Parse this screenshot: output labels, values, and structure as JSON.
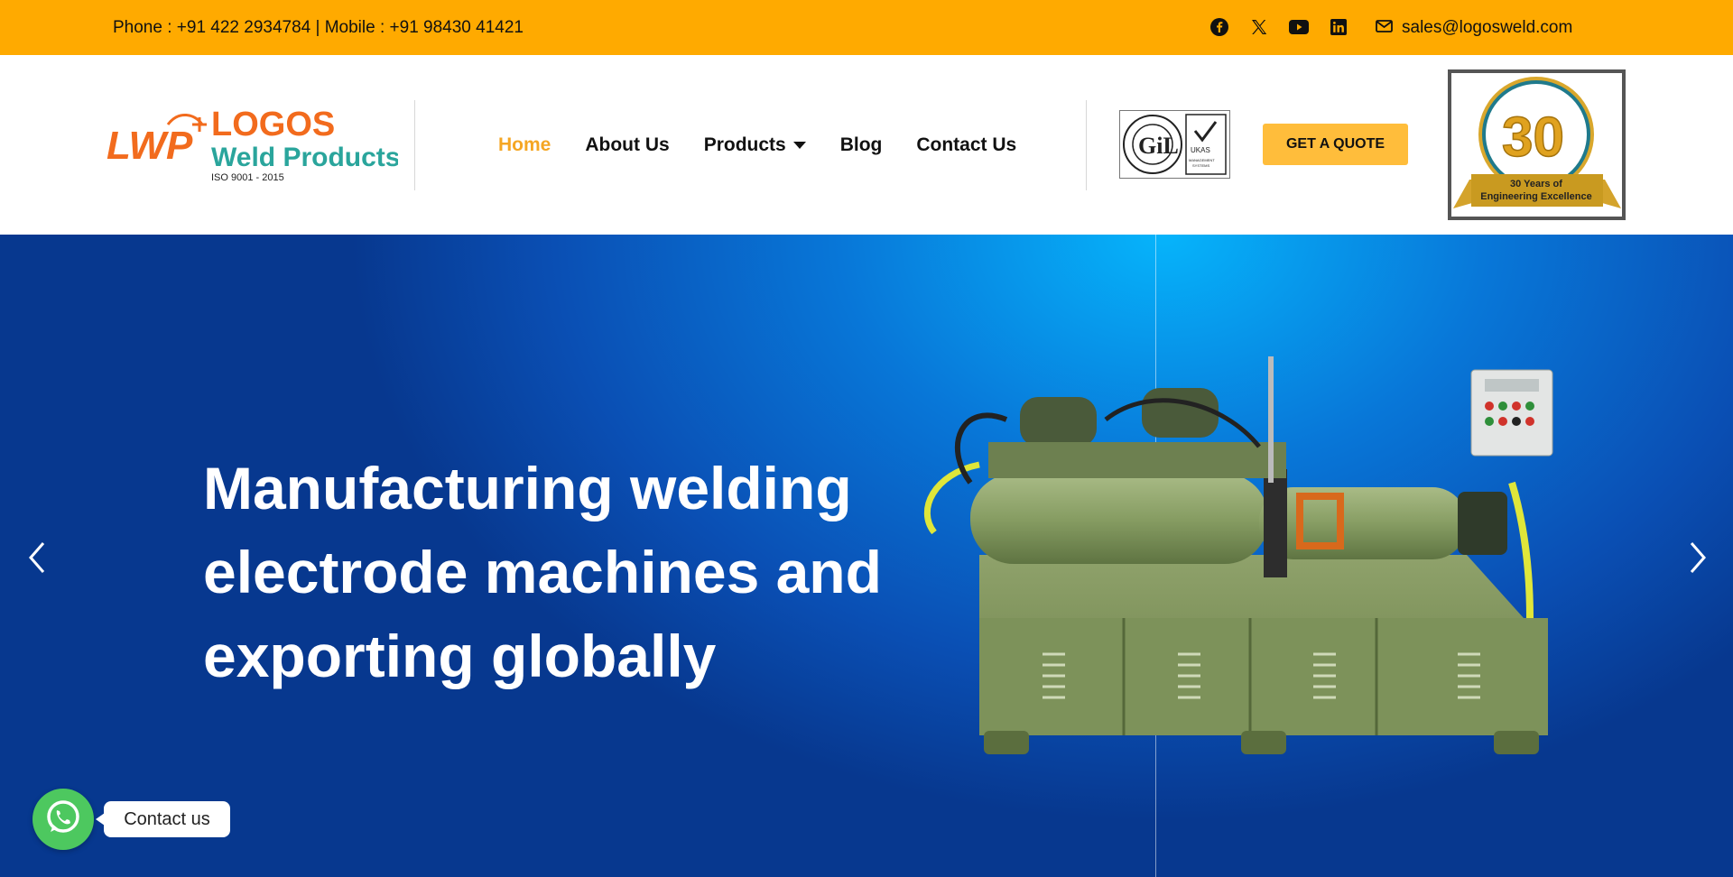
{
  "topbar": {
    "contact_text": "Phone : +91 422 2934784 | Mobile : +91 98430 41421",
    "social_icons": [
      "facebook-icon",
      "x-twitter-icon",
      "youtube-icon",
      "linkedin-icon"
    ],
    "email": "sales@logosweld.com",
    "background_color": "#ffaa00"
  },
  "header": {
    "logo": {
      "mark": "LWP",
      "name_line1": "LOGOS",
      "name_line2": "Weld Products",
      "tagline": "ISO 9001 - 2015"
    },
    "nav": {
      "items": [
        {
          "label": "Home",
          "active": true
        },
        {
          "label": "About Us"
        },
        {
          "label": "Products",
          "has_dropdown": true
        },
        {
          "label": "Blog"
        },
        {
          "label": "Contact Us"
        }
      ],
      "active_color": "#f5a623"
    },
    "certification": {
      "left_text": "GUARDIAN INDEPENDENT CERTIFICATION",
      "right_text": "UKAS MANAGEMENT SYSTEMS"
    },
    "quote_button": "GET A QUOTE",
    "anniversary_badge": {
      "number": "30",
      "line1": "30 Years of",
      "line2": "Engineering Excellence"
    }
  },
  "hero": {
    "heading_lines": [
      "Manufacturing welding",
      "electrode machines and",
      "exporting globally"
    ],
    "prev_icon": "chevron-left-icon",
    "next_icon": "chevron-right-icon"
  },
  "whatsapp": {
    "icon": "whatsapp-icon",
    "label": "Contact us"
  }
}
